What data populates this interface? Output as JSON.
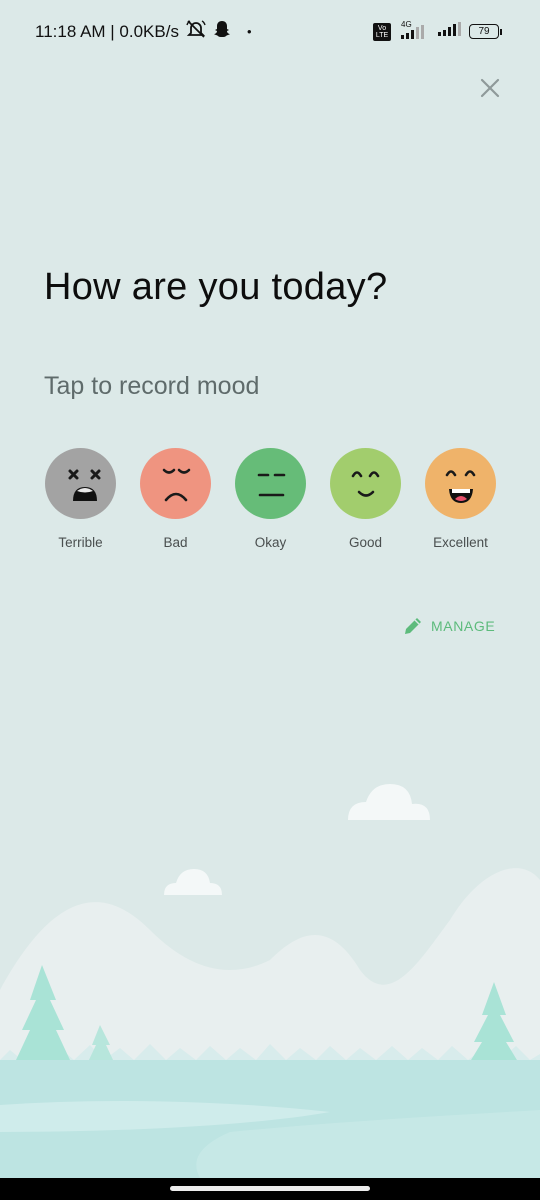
{
  "status_bar": {
    "time_speed": "11:18 AM | 0.0KB/s",
    "dot": "•",
    "volte": "Vo LTE",
    "network": "4G",
    "battery": "79"
  },
  "header": {
    "title": "How are you today?",
    "subtitle": "Tap to record mood",
    "close_icon": "close-icon"
  },
  "moods": [
    {
      "label": "Terrible",
      "color": "#a3a3a3",
      "icon": "terrible-face-icon"
    },
    {
      "label": "Bad",
      "color": "#ef9480",
      "icon": "bad-face-icon"
    },
    {
      "label": "Okay",
      "color": "#66bc78",
      "icon": "okay-face-icon"
    },
    {
      "label": "Good",
      "color": "#a2cd6d",
      "icon": "good-face-icon"
    },
    {
      "label": "Excellent",
      "color": "#efb36a",
      "icon": "excellent-face-icon"
    }
  ],
  "manage": {
    "label": "MANAGE",
    "icon": "pencil-icon",
    "color": "#5dbb7c"
  },
  "colors": {
    "background": "#dce9e8",
    "accent": "#5dbb7c",
    "tree": "#a9e3d6",
    "ground": "#bde4e2"
  }
}
